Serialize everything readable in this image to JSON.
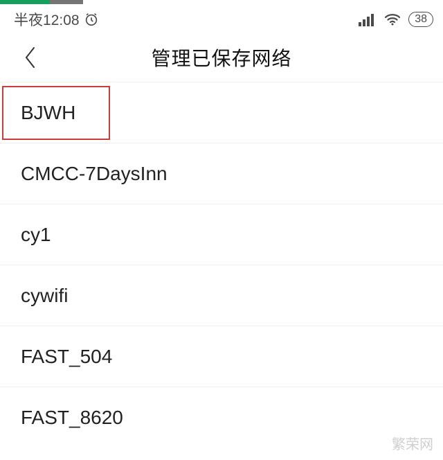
{
  "statusBar": {
    "timeLabel": "半夜12:08",
    "battery": "38"
  },
  "nav": {
    "title": "管理已保存网络"
  },
  "networks": [
    {
      "ssid": "BJWH",
      "highlighted": true
    },
    {
      "ssid": "CMCC-7DaysInn",
      "highlighted": false
    },
    {
      "ssid": "cy1",
      "highlighted": false
    },
    {
      "ssid": "cywifi",
      "highlighted": false
    },
    {
      "ssid": "FAST_504",
      "highlighted": false
    },
    {
      "ssid": "FAST_8620",
      "highlighted": false
    }
  ],
  "watermark": "繁荣网"
}
